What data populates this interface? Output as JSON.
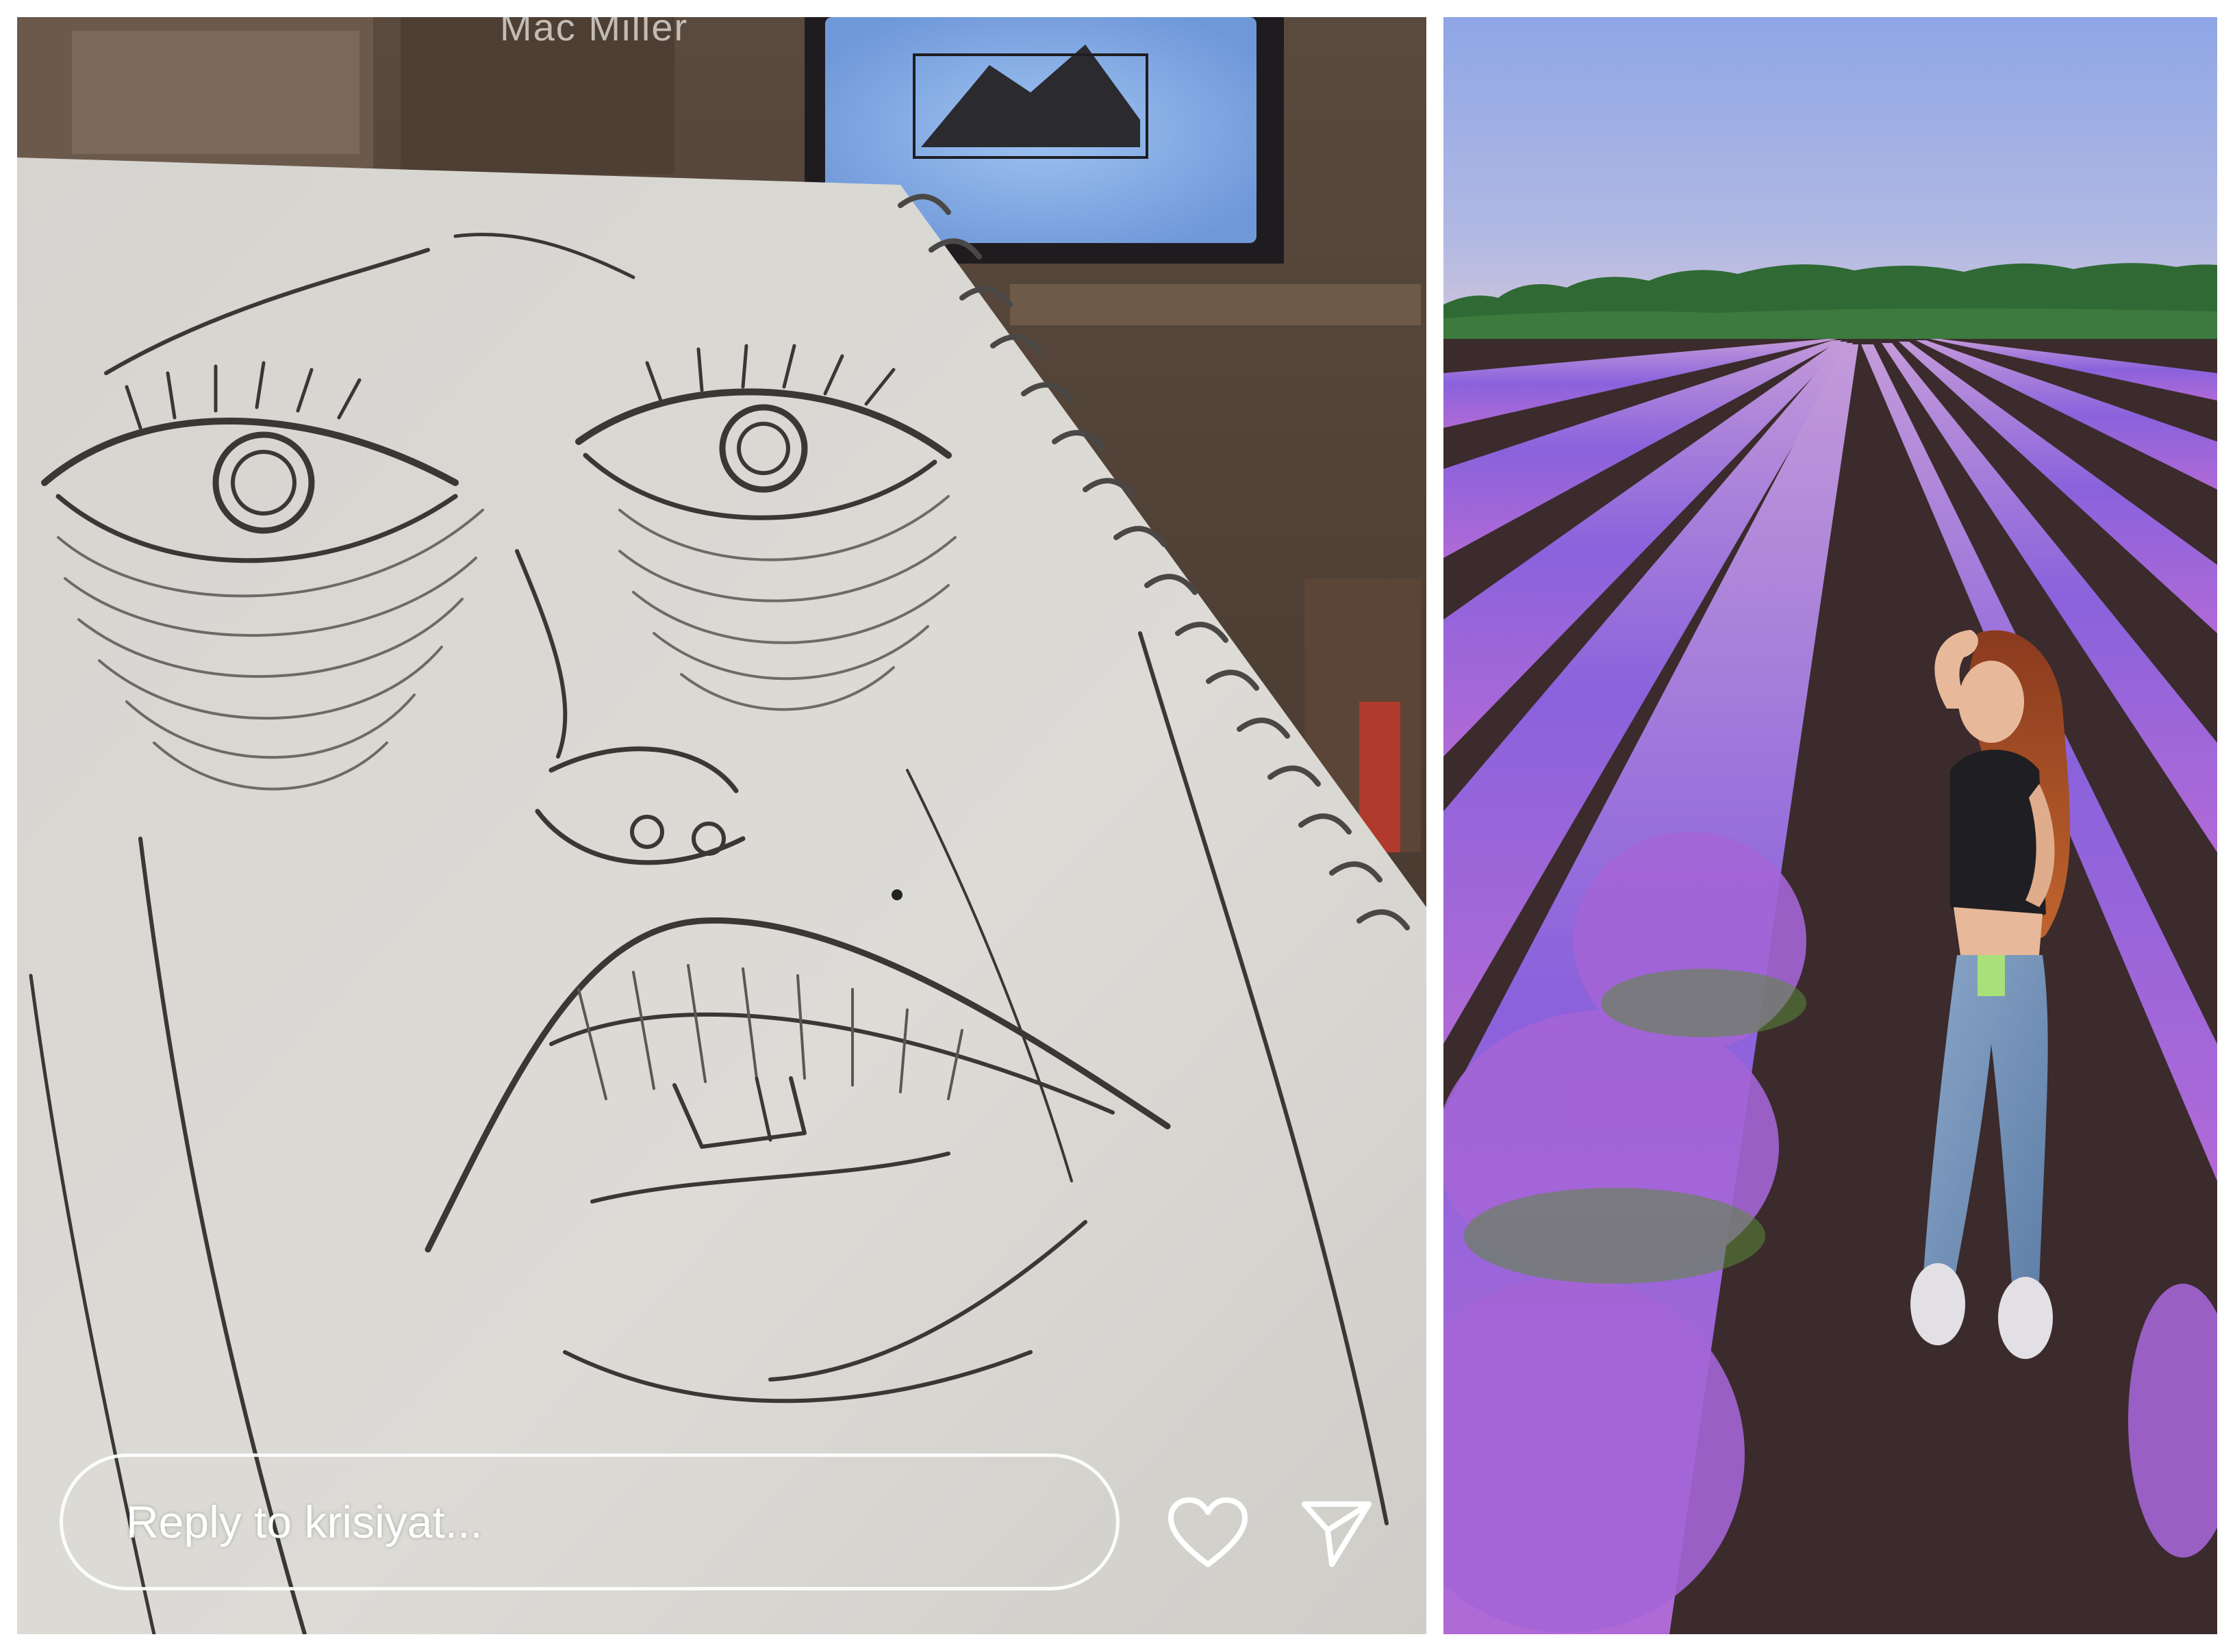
{
  "story": {
    "caption": "Mac Miller",
    "reply_placeholder": "Reply to krisiyat...",
    "icons": {
      "like": "heart-icon",
      "share": "send-icon"
    }
  },
  "photo": {
    "alt": "lavender field photo"
  },
  "colors": {
    "sky": "#a9b6e8",
    "lavender": "#8a5cd6",
    "soil": "#3a2c2a",
    "paper": "#d9d7d2"
  }
}
